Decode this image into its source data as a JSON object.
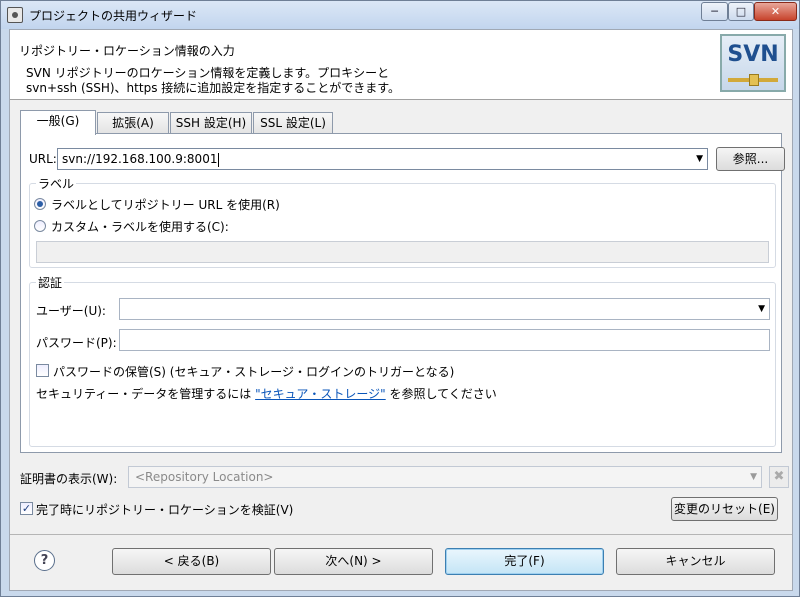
{
  "window": {
    "title": "プロジェクトの共用ウィザード",
    "controls": {
      "minimize": "─",
      "maximize": "□",
      "close": "✕"
    }
  },
  "banner": {
    "title": "リポジトリー・ロケーション情報の入力",
    "description_line1": "SVN リポジトリーのロケーション情報を定義します。プロキシーと",
    "description_line2": "svn+ssh (SSH)、https 接続に追加設定を指定することができます。",
    "logo_text": "SVN"
  },
  "tabs": [
    {
      "label": "一般(G)",
      "active": true
    },
    {
      "label": "拡張(A)",
      "active": false
    },
    {
      "label": "SSH 設定(H)",
      "active": false
    },
    {
      "label": "SSL 設定(L)",
      "active": false
    }
  ],
  "url": {
    "label": "URL:",
    "value": "svn://192.168.100.9:8001",
    "browse_label": "参照..."
  },
  "label_group": {
    "title": "ラベル",
    "option_url": "ラベルとしてリポジトリー URL を使用(R)",
    "option_custom": "カスタム・ラベルを使用する(C):",
    "custom_value": ""
  },
  "auth_group": {
    "title": "認証",
    "user_label": "ユーザー(U):",
    "user_value": "",
    "password_label": "パスワード(P):",
    "password_value": "",
    "save_password_label": "パスワードの保管(S) (セキュア・ストレージ・ログインのトリガーとなる)",
    "secure_prefix": "セキュリティー・データを管理するには",
    "secure_link": "\"セキュア・ストレージ\"",
    "secure_suffix": "を参照してください"
  },
  "certificate": {
    "label": "証明書の表示(W):",
    "placeholder": "<Repository Location>",
    "clear_icon": "✖"
  },
  "validate": {
    "label": "完了時にリポジトリー・ロケーションを検証(V)",
    "checked": true
  },
  "reset_label": "変更のリセット(E)",
  "footer": {
    "help_icon": "?",
    "back_label": "< 戻る(B)",
    "next_label": "次へ(N) >",
    "finish_label": "完了(F)",
    "cancel_label": "キャンセル"
  }
}
